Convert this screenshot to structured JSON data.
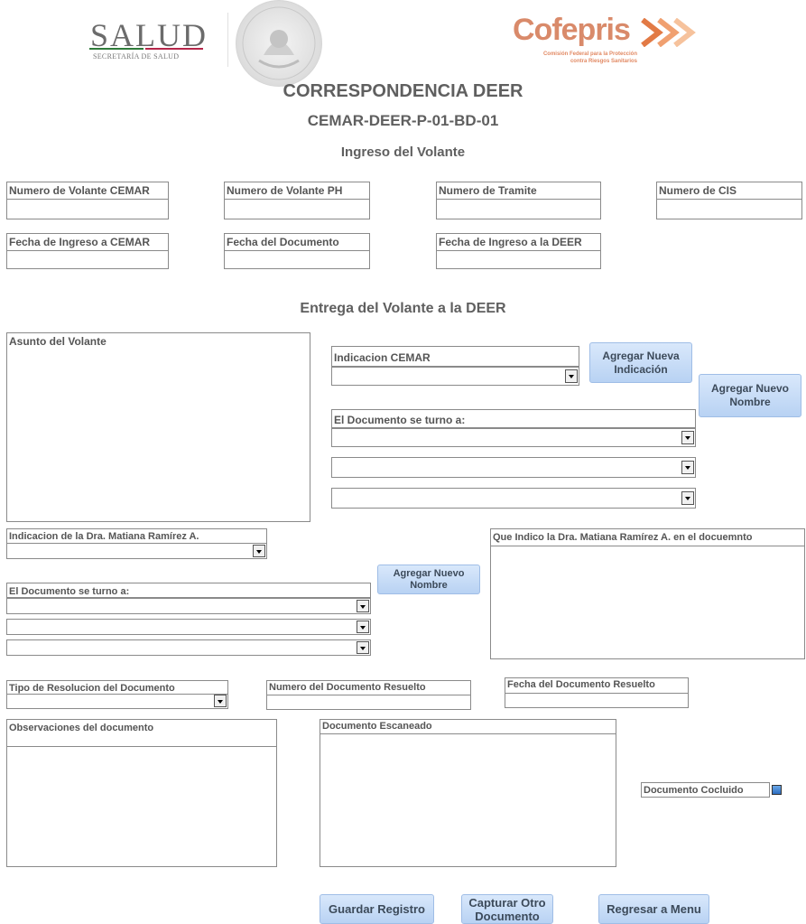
{
  "header": {
    "salud_title": "SALUD",
    "salud_subtitle": "SECRETARÍA DE SALUD",
    "cofepris_title": "Cofepris",
    "cofepris_sub1": "Comisión Federal para la Protección",
    "cofepris_sub2": "contra Riesgos Sanitarios",
    "main_title": "CORRESPONDENCIA DEER",
    "code": "CEMAR-DEER-P-01-BD-01"
  },
  "section1": {
    "title": "Ingreso del Volante",
    "fields": {
      "volante_cemar": {
        "label": "Numero de Volante CEMAR",
        "value": ""
      },
      "volante_ph": {
        "label": "Numero de Volante PH",
        "value": ""
      },
      "tramite": {
        "label": "Numero de Tramite",
        "value": ""
      },
      "cis": {
        "label": "Numero de CIS",
        "value": ""
      },
      "fecha_cemar": {
        "label": "Fecha de Ingreso a CEMAR",
        "value": ""
      },
      "fecha_documento": {
        "label": "Fecha del Documento",
        "value": ""
      },
      "fecha_deer": {
        "label": "Fecha de Ingreso a la DEER",
        "value": ""
      }
    }
  },
  "section2": {
    "title": "Entrega del Volante a la DEER",
    "asunto_label": "Asunto del Volante",
    "indicacion_cemar_label": "Indicacion CEMAR",
    "agregar_indicacion_btn": "Agregar Nueva Indicación",
    "turno_label": "El Documento se turno a:",
    "agregar_nombre_btn": "Agregar Nuevo Nombre",
    "indicacion_dra_label": "Indicacion de la Dra. Matiana Ramírez A.",
    "turno_label2": "El Documento se turno a:",
    "agregar_nombre_btn2": "Agregar Nuevo Nombre",
    "que_indico_label": "Que Indico la Dra. Matiana Ramírez A. en el docuemnto",
    "tipo_resolucion_label": "Tipo de Resolucion del Documento",
    "numero_resuelto_label": "Numero del Documento Resuelto",
    "fecha_resuelto_label": "Fecha del Documento Resuelto",
    "observaciones_label": "Observaciones del documento",
    "escaneado_label": "Documento Escaneado",
    "concluido_label": "Documento Cocluido"
  },
  "buttons": {
    "guardar": "Guardar Registro",
    "capturar": "Capturar Otro Documento",
    "regresar": "Regresar a Menu"
  },
  "colors": {
    "button_bg": "#c6dcf6",
    "cofepris": "#d98a6a",
    "salud_red": "#b5264a",
    "salud_green": "#2f7a3a"
  }
}
